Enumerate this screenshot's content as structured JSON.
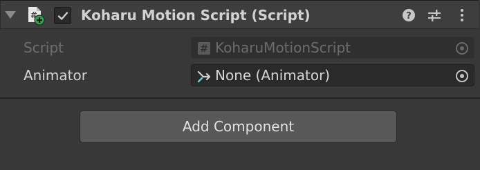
{
  "component": {
    "title": "Koharu Motion Script (Script)",
    "enabled": true,
    "icons": {
      "foldout": "triangle-down-icon",
      "script": "script-file-icon",
      "help": "help-icon",
      "presets": "presets-sliders-icon",
      "menu": "kebab-menu-icon"
    }
  },
  "properties": [
    {
      "label": "Script",
      "value": "KoharuMotionScript",
      "icon": "hash-icon",
      "disabled": true
    },
    {
      "label": "Animator",
      "value": "None (Animator)",
      "icon": "animator-icon",
      "disabled": false
    }
  ],
  "add_component_label": "Add Component",
  "colors": {
    "background": "#383838",
    "header": "#3e3e3e",
    "button": "#585858",
    "script_icon_green": "#2fa44a",
    "animator_icon_cyan": "#5fd1d1"
  }
}
